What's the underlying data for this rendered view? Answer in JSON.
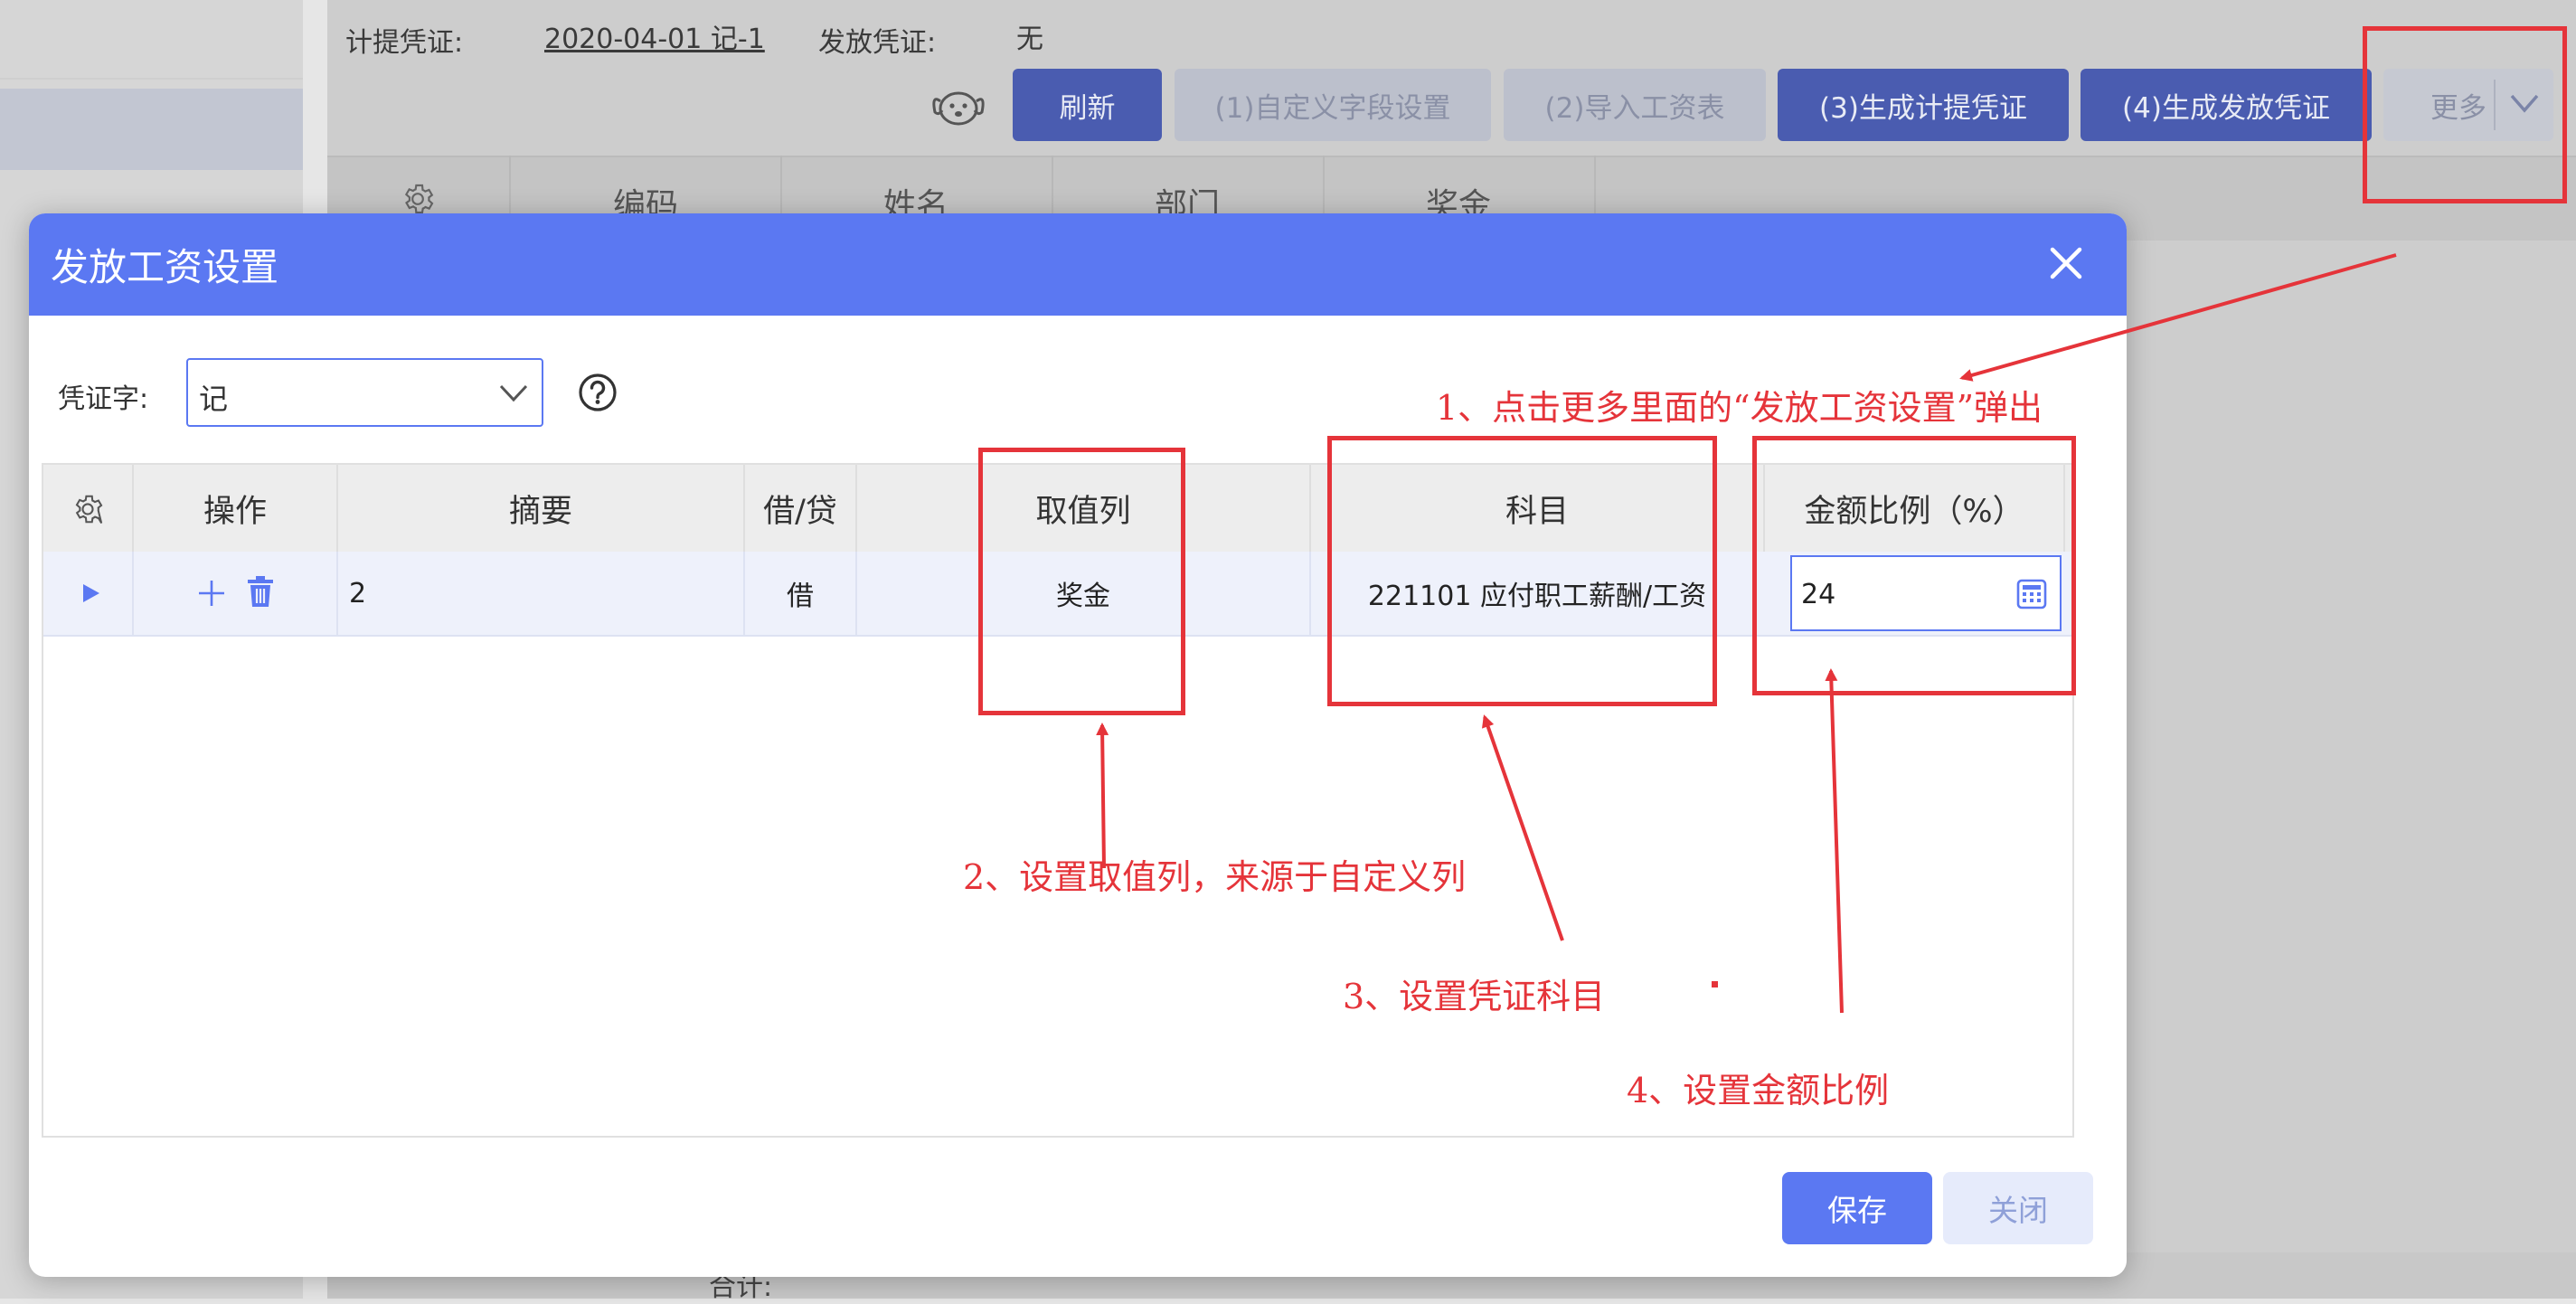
{
  "background": {
    "accrual_label": "计提凭证:",
    "accrual_value": "2020-04-01 记-1",
    "issue_label": "发放凭证:",
    "issue_value": "无",
    "buttons": {
      "refresh": "刷新",
      "custom_fields": "(1)自定义字段设置",
      "import_payroll": "(2)导入工资表",
      "gen_accrual": "(3)生成计提凭证",
      "gen_issue": "(4)生成发放凭证",
      "more": "更多"
    },
    "table_headers": [
      "编码",
      "姓名",
      "部门",
      "奖金"
    ],
    "total_label": "合计:"
  },
  "dialog": {
    "title": "发放工资设置",
    "voucher_label": "凭证字:",
    "voucher_value": "记",
    "columns": {
      "operation": "操作",
      "summary": "摘要",
      "debit_credit": "借/贷",
      "value_column": "取值列",
      "account": "科目",
      "amount_ratio": "金额比例（%）"
    },
    "rows": [
      {
        "summary": "2",
        "debit_credit": "借",
        "value_column": "奖金",
        "account": "221101 应付职工薪酬/工资",
        "amount_ratio": "24"
      }
    ],
    "save_label": "保存",
    "close_label": "关闭"
  },
  "annotations": {
    "step1": "1、点击更多里面的“发放工资设置”弹出",
    "step2": "2、设置取值列，来源于自定义列",
    "step3": "3、设置凭证科目",
    "step4": "4、设置金额比例",
    "color": "#e5343a"
  },
  "colors": {
    "primary": "#5b78f2",
    "annotation": "#e5343a"
  },
  "icons": {
    "settings": "gear-icon",
    "add": "plus-icon",
    "delete": "trash-icon",
    "expand": "play-icon",
    "help": "question-icon",
    "calculator": "calculator-icon",
    "close": "close-icon",
    "dropdown": "chevron-down-icon",
    "mascot": "dog-icon"
  }
}
